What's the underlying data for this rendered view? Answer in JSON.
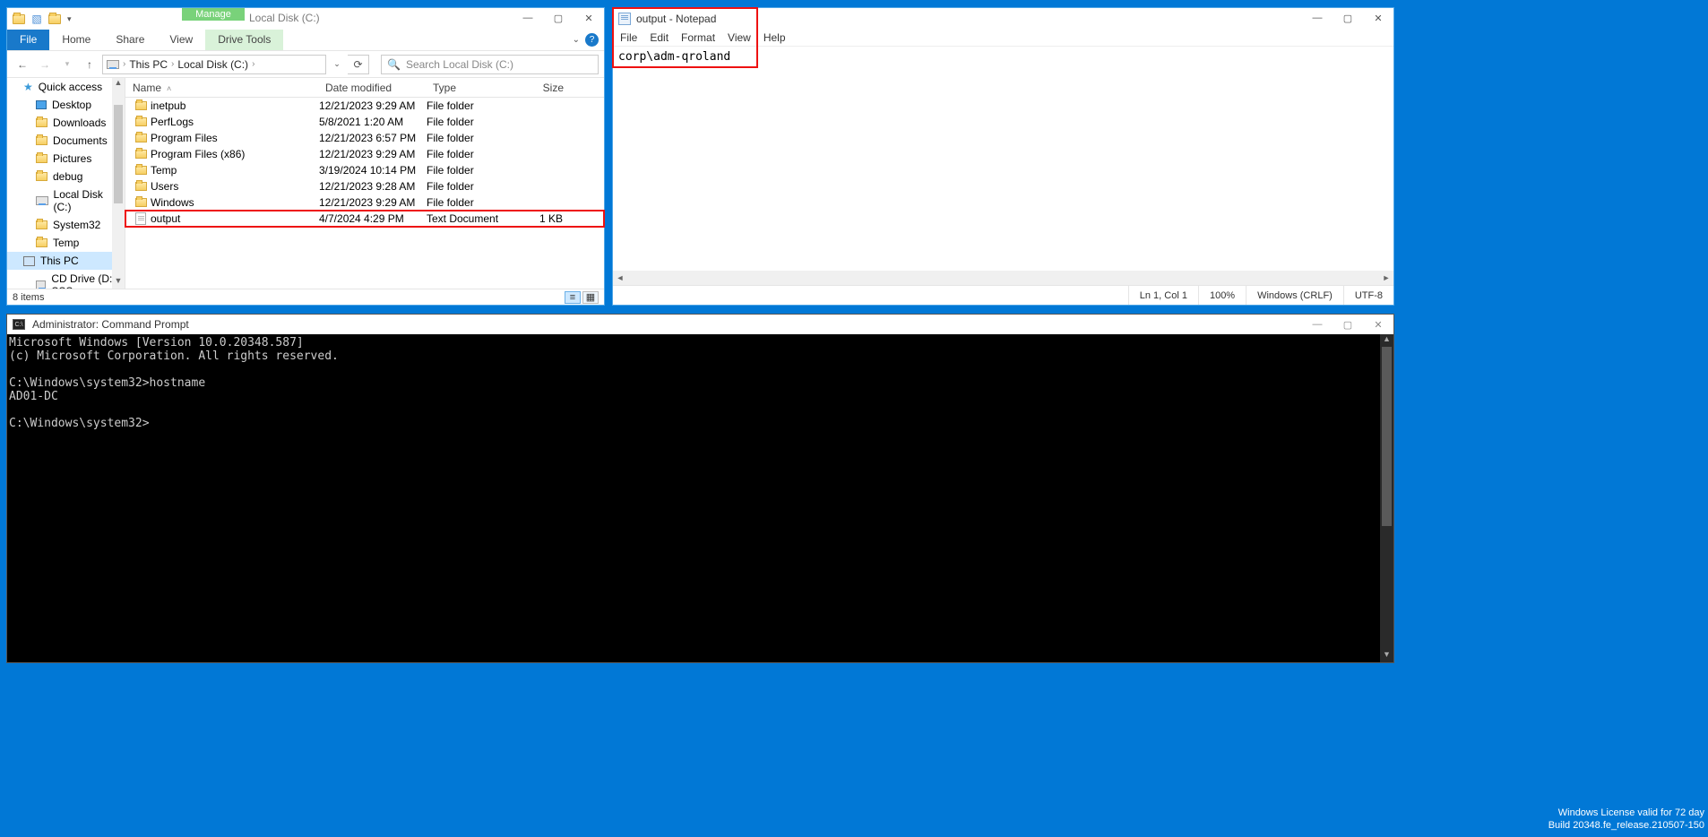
{
  "explorer": {
    "context_tab": "Manage",
    "title": "Local Disk (C:)",
    "ribbon": {
      "file": "File",
      "home": "Home",
      "share": "Share",
      "view": "View",
      "drive": "Drive Tools"
    },
    "breadcrumb": {
      "root": "This PC",
      "current": "Local Disk (C:)"
    },
    "search_placeholder": "Search Local Disk (C:)",
    "columns": {
      "name": "Name",
      "date": "Date modified",
      "type": "Type",
      "size": "Size"
    },
    "rows": [
      {
        "kind": "folder",
        "name": "inetpub",
        "date": "12/21/2023 9:29 AM",
        "type": "File folder",
        "size": ""
      },
      {
        "kind": "folder",
        "name": "PerfLogs",
        "date": "5/8/2021 1:20 AM",
        "type": "File folder",
        "size": ""
      },
      {
        "kind": "folder",
        "name": "Program Files",
        "date": "12/21/2023 6:57 PM",
        "type": "File folder",
        "size": ""
      },
      {
        "kind": "folder",
        "name": "Program Files (x86)",
        "date": "12/21/2023 9:29 AM",
        "type": "File folder",
        "size": ""
      },
      {
        "kind": "folder",
        "name": "Temp",
        "date": "3/19/2024 10:14 PM",
        "type": "File folder",
        "size": ""
      },
      {
        "kind": "folder",
        "name": "Users",
        "date": "12/21/2023 9:28 AM",
        "type": "File folder",
        "size": ""
      },
      {
        "kind": "folder",
        "name": "Windows",
        "date": "12/21/2023 9:29 AM",
        "type": "File folder",
        "size": ""
      },
      {
        "kind": "file",
        "name": "output",
        "date": "4/7/2024 4:29 PM",
        "type": "Text Document",
        "size": "1 KB",
        "highlight": true
      }
    ],
    "tree": [
      {
        "label": "Quick access",
        "icon": "star"
      },
      {
        "label": "Desktop",
        "icon": "desktop",
        "indent": true
      },
      {
        "label": "Downloads",
        "icon": "folder",
        "indent": true
      },
      {
        "label": "Documents",
        "icon": "folder",
        "indent": true
      },
      {
        "label": "Pictures",
        "icon": "folder",
        "indent": true
      },
      {
        "label": "debug",
        "icon": "folder",
        "indent": true
      },
      {
        "label": "Local Disk (C:)",
        "icon": "drive",
        "indent": true
      },
      {
        "label": "System32",
        "icon": "folder",
        "indent": true
      },
      {
        "label": "Temp",
        "icon": "folder",
        "indent": true
      },
      {
        "label": "This PC",
        "icon": "pc",
        "selected": true
      },
      {
        "label": "CD Drive (D:) SSS",
        "icon": "drive",
        "indent": true
      }
    ],
    "status": "8 items"
  },
  "notepad": {
    "title": "output - Notepad",
    "menu": [
      "File",
      "Edit",
      "Format",
      "View",
      "Help"
    ],
    "content": "corp\\adm-qroland",
    "status": {
      "pos": "Ln 1, Col 1",
      "zoom": "100%",
      "eol": "Windows (CRLF)",
      "enc": "UTF-8"
    }
  },
  "cmd": {
    "title": "Administrator: Command Prompt",
    "lines": [
      "Microsoft Windows [Version 10.0.20348.587]",
      "(c) Microsoft Corporation. All rights reserved.",
      "",
      "C:\\Windows\\system32>hostname",
      "AD01-DC",
      "",
      "C:\\Windows\\system32>"
    ]
  },
  "watermark": {
    "line1": "Windows License valid for 72 day",
    "line2": "Build 20348.fe_release.210507-150"
  }
}
